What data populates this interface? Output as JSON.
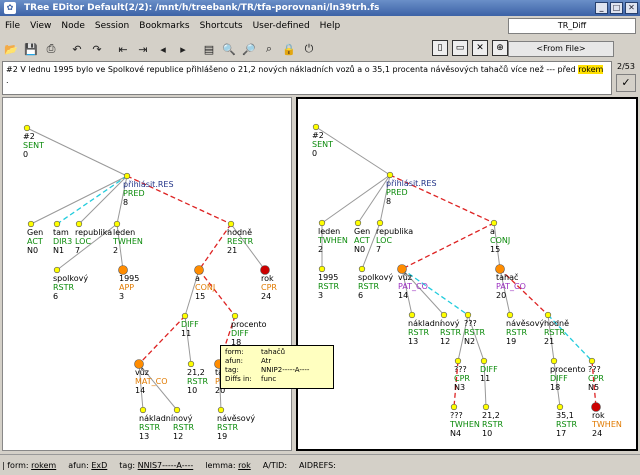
{
  "window": {
    "title": "TRee EDitor   Default(2/2): /mnt/h/treebank/TR/tfa-porovnani/ln39trh.fs"
  },
  "menu": {
    "items": [
      "File",
      "View",
      "Node",
      "Session",
      "Bookmarks",
      "Shortcuts",
      "User-defined",
      "Help"
    ]
  },
  "top_combo": "TR_Diff",
  "from_file": "<From File>",
  "sentence": {
    "pre": "#2 V lednu 1995 bylo ve Spolkové republice přihlášeno o 21,2  nových nákladních vozů a o 35,1 procenta návěsových tahačů více než --- před ",
    "highlight": "rokem",
    "post": " ."
  },
  "pager": "2/53",
  "colors": {
    "act": "#006400",
    "func": "#006400",
    "tfa_f": "#e07000",
    "yellow": "#ffff00",
    "orange": "#ff8c00",
    "red": "#cc0000"
  },
  "left_tree": {
    "nodes": [
      {
        "id": "root",
        "lines": [
          "#2",
          "SENT",
          "0"
        ]
      },
      {
        "id": "pred",
        "lines": [
          "přihlásit.RES",
          "PRED",
          "8"
        ]
      },
      {
        "id": "gen",
        "lines": [
          "Gen",
          "ACT",
          "N0"
        ]
      },
      {
        "id": "tam",
        "lines": [
          "tam",
          "DIR3",
          "N1"
        ]
      },
      {
        "id": "rep",
        "lines": [
          "republika",
          "LOC",
          "7"
        ]
      },
      {
        "id": "leden",
        "lines": [
          "leden",
          "TWHEN",
          "2"
        ]
      },
      {
        "id": "hodne",
        "lines": [
          "hodně",
          "RESTR",
          "21"
        ]
      },
      {
        "id": "spol",
        "lines": [
          "spolkový",
          "RSTR",
          "6"
        ]
      },
      {
        "id": "y1995",
        "lines": [
          "1995",
          "APP",
          "3"
        ]
      },
      {
        "id": "a",
        "lines": [
          "a",
          "CONJ",
          "15"
        ]
      },
      {
        "id": "rok",
        "lines": [
          "rok",
          "CPR",
          "24"
        ]
      },
      {
        "id": "diff11",
        "lines": [
          "DIFF",
          "11"
        ]
      },
      {
        "id": "proc",
        "lines": [
          "procento",
          "DIFF",
          "18"
        ]
      },
      {
        "id": "vuz",
        "lines": [
          "vůz",
          "MAT_CO",
          "14"
        ]
      },
      {
        "id": "n212",
        "lines": [
          "21,2",
          "RSTR",
          "10"
        ]
      },
      {
        "id": "tah",
        "lines": [
          "tahač",
          "PAT_CO",
          "20"
        ]
      },
      {
        "id": "nakl",
        "lines": [
          "nákladní",
          "RSTR",
          "13"
        ]
      },
      {
        "id": "novy",
        "lines": [
          "nový",
          "RSTR",
          "12"
        ]
      },
      {
        "id": "naves",
        "lines": [
          "návěsový",
          "RSTR",
          "19"
        ]
      }
    ]
  },
  "right_tree": {
    "nodes": [
      {
        "id": "root",
        "lines": [
          "#2",
          "SENT",
          "0"
        ]
      },
      {
        "id": "pred",
        "lines": [
          "přihlásit.RES",
          "PRED",
          "8"
        ]
      },
      {
        "id": "leden",
        "lines": [
          "leden",
          "TWHEN",
          "2"
        ]
      },
      {
        "id": "gen",
        "lines": [
          "Gen",
          "ACT",
          "N0"
        ]
      },
      {
        "id": "rep",
        "lines": [
          "republika",
          "LOC",
          "7"
        ]
      },
      {
        "id": "a",
        "lines": [
          "a",
          "CONJ",
          "15"
        ]
      },
      {
        "id": "y1995",
        "lines": [
          "1995",
          "RSTR",
          "3"
        ]
      },
      {
        "id": "spol",
        "lines": [
          "spolkový",
          "RSTR",
          "6"
        ]
      },
      {
        "id": "vuz",
        "lines": [
          "vůz",
          "PAT_CO",
          "14"
        ]
      },
      {
        "id": "tah",
        "lines": [
          "tahač",
          "PAT_CO",
          "20"
        ]
      },
      {
        "id": "nakl",
        "lines": [
          "nákladní",
          "RSTR",
          "13"
        ]
      },
      {
        "id": "novy",
        "lines": [
          "nový",
          "RSTR",
          "12"
        ]
      },
      {
        "id": "q1",
        "lines": [
          "???",
          "RSTR",
          "N2"
        ]
      },
      {
        "id": "naves",
        "lines": [
          "návěsový",
          "RSTR",
          "19"
        ]
      },
      {
        "id": "hodne",
        "lines": [
          "hodně",
          "RSTR",
          "21"
        ]
      },
      {
        "id": "q2",
        "lines": [
          "???",
          "CPR",
          "N3"
        ]
      },
      {
        "id": "diff11",
        "lines": [
          "DIFF",
          "11"
        ]
      },
      {
        "id": "proc",
        "lines": [
          "procento",
          "DIFF",
          "18"
        ]
      },
      {
        "id": "q3",
        "lines": [
          "???",
          "CPR",
          "N5"
        ]
      },
      {
        "id": "q4",
        "lines": [
          "???",
          "TWHEN",
          "N4"
        ]
      },
      {
        "id": "n212",
        "lines": [
          "21,2",
          "RSTR",
          "10"
        ]
      },
      {
        "id": "n351",
        "lines": [
          "35,1",
          "RSTR",
          "17"
        ]
      },
      {
        "id": "rok",
        "lines": [
          "rok",
          "TWHEN",
          "24"
        ]
      }
    ]
  },
  "tooltip": {
    "rows": [
      {
        "k": "form:",
        "v": "tahačů"
      },
      {
        "k": "afun:",
        "v": "Atr"
      },
      {
        "k": "tag:",
        "v": "NNIP2-----A----"
      },
      {
        "k": "Diffs in:",
        "v": "func"
      }
    ]
  },
  "status": {
    "form_label": "| form:",
    "form_value": "rokem",
    "afun_label": "afun:",
    "afun_value": "ExD",
    "tag_label": "tag:",
    "tag_value": "NNIS7-----A----",
    "lemma_label": "lemma:",
    "lemma_value": "rok",
    "atid": "A/TID:",
    "aidrefs": "AIDREFS:"
  }
}
